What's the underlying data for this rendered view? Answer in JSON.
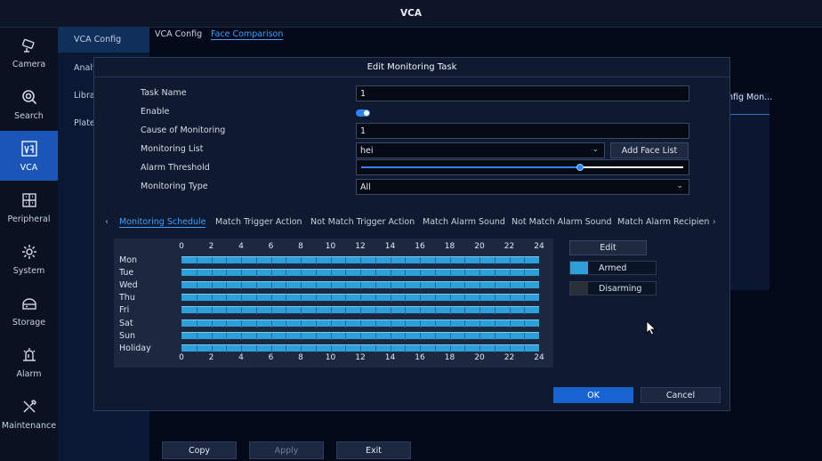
{
  "window": {
    "title": "VCA"
  },
  "sidebar": {
    "items": [
      {
        "label": "Camera",
        "icon": "camera-icon"
      },
      {
        "label": "Search",
        "icon": "search-icon"
      },
      {
        "label": "VCA",
        "icon": "vca-icon",
        "active": true
      },
      {
        "label": "Peripheral",
        "icon": "peripheral-icon"
      },
      {
        "label": "System",
        "icon": "gear-icon"
      },
      {
        "label": "Storage",
        "icon": "storage-icon"
      },
      {
        "label": "Alarm",
        "icon": "alarm-icon"
      },
      {
        "label": "Maintenance",
        "icon": "tools-icon"
      }
    ]
  },
  "subnav": {
    "items": [
      {
        "label": "VCA Config"
      },
      {
        "label": "Analy"
      },
      {
        "label": "Libra"
      },
      {
        "label": "Plate"
      }
    ]
  },
  "top_tabs": [
    {
      "label": "VCA Config"
    },
    {
      "label": "Face Comparison"
    }
  ],
  "background": {
    "partial_tab": "nfig Mon..."
  },
  "dialog": {
    "title": "Edit Monitoring Task",
    "fields": {
      "task_name": {
        "label": "Task Name",
        "value": "1"
      },
      "enable": {
        "label": "Enable",
        "on": true
      },
      "cause": {
        "label": "Cause of Monitoring",
        "value": "1"
      },
      "monitoring_list": {
        "label": "Monitoring List",
        "value": "hei"
      },
      "add_face_list": "Add Face List",
      "alarm_threshold": {
        "label": "Alarm Threshold",
        "level": 0.68
      },
      "monitoring_type": {
        "label": "Monitoring Type",
        "value": "All"
      }
    },
    "tabs": [
      {
        "label": "Monitoring Schedule",
        "active": true
      },
      {
        "label": "Match Trigger Action"
      },
      {
        "label": "Not Match Trigger Action"
      },
      {
        "label": "Match Alarm Sound"
      },
      {
        "label": "Not Match Alarm Sound"
      },
      {
        "label": "Match Alarm Recipien"
      }
    ],
    "tab_prev": "‹",
    "tab_next": "›",
    "schedule": {
      "hours": [
        "0",
        "2",
        "4",
        "6",
        "8",
        "10",
        "12",
        "14",
        "16",
        "18",
        "20",
        "22",
        "24"
      ],
      "days": [
        "Mon",
        "Tue",
        "Wed",
        "Thu",
        "Fri",
        "Sat",
        "Sun",
        "Holiday"
      ]
    },
    "edit_label": "Edit",
    "legend": [
      {
        "label": "Armed",
        "color": "#2d9fd9"
      },
      {
        "label": "Disarming",
        "color": "#2a2f38"
      }
    ],
    "ok_label": "OK",
    "cancel_label": "Cancel"
  },
  "bottom": {
    "copy": "Copy",
    "apply": "Apply",
    "exit": "Exit"
  },
  "colors": {
    "accent": "#3aa0ff",
    "active_nav": "#1a56b8",
    "armed": "#2d9fd9"
  }
}
